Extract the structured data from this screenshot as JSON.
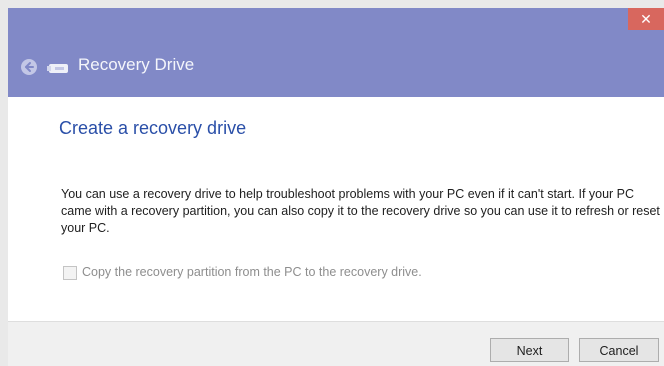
{
  "titlebar": {
    "title": "Recovery Drive",
    "close_glyph": "✕",
    "back_icon": "back-arrow-icon",
    "drive_icon": "usb-drive-icon",
    "color": "#8189c7",
    "close_color": "#d8675e"
  },
  "content": {
    "heading": "Create a recovery drive",
    "description": "You can use a recovery drive to help troubleshoot problems with your PC even if it can't start. If your PC came with a recovery partition, you can also copy it to the recovery drive so you can use it to refresh or reset your PC.",
    "checkbox": {
      "label": "Copy the recovery partition from the PC to the recovery drive.",
      "checked": false,
      "disabled": true
    },
    "heading_color": "#2a4fa8"
  },
  "footer": {
    "next_label": "Next",
    "cancel_label": "Cancel"
  }
}
